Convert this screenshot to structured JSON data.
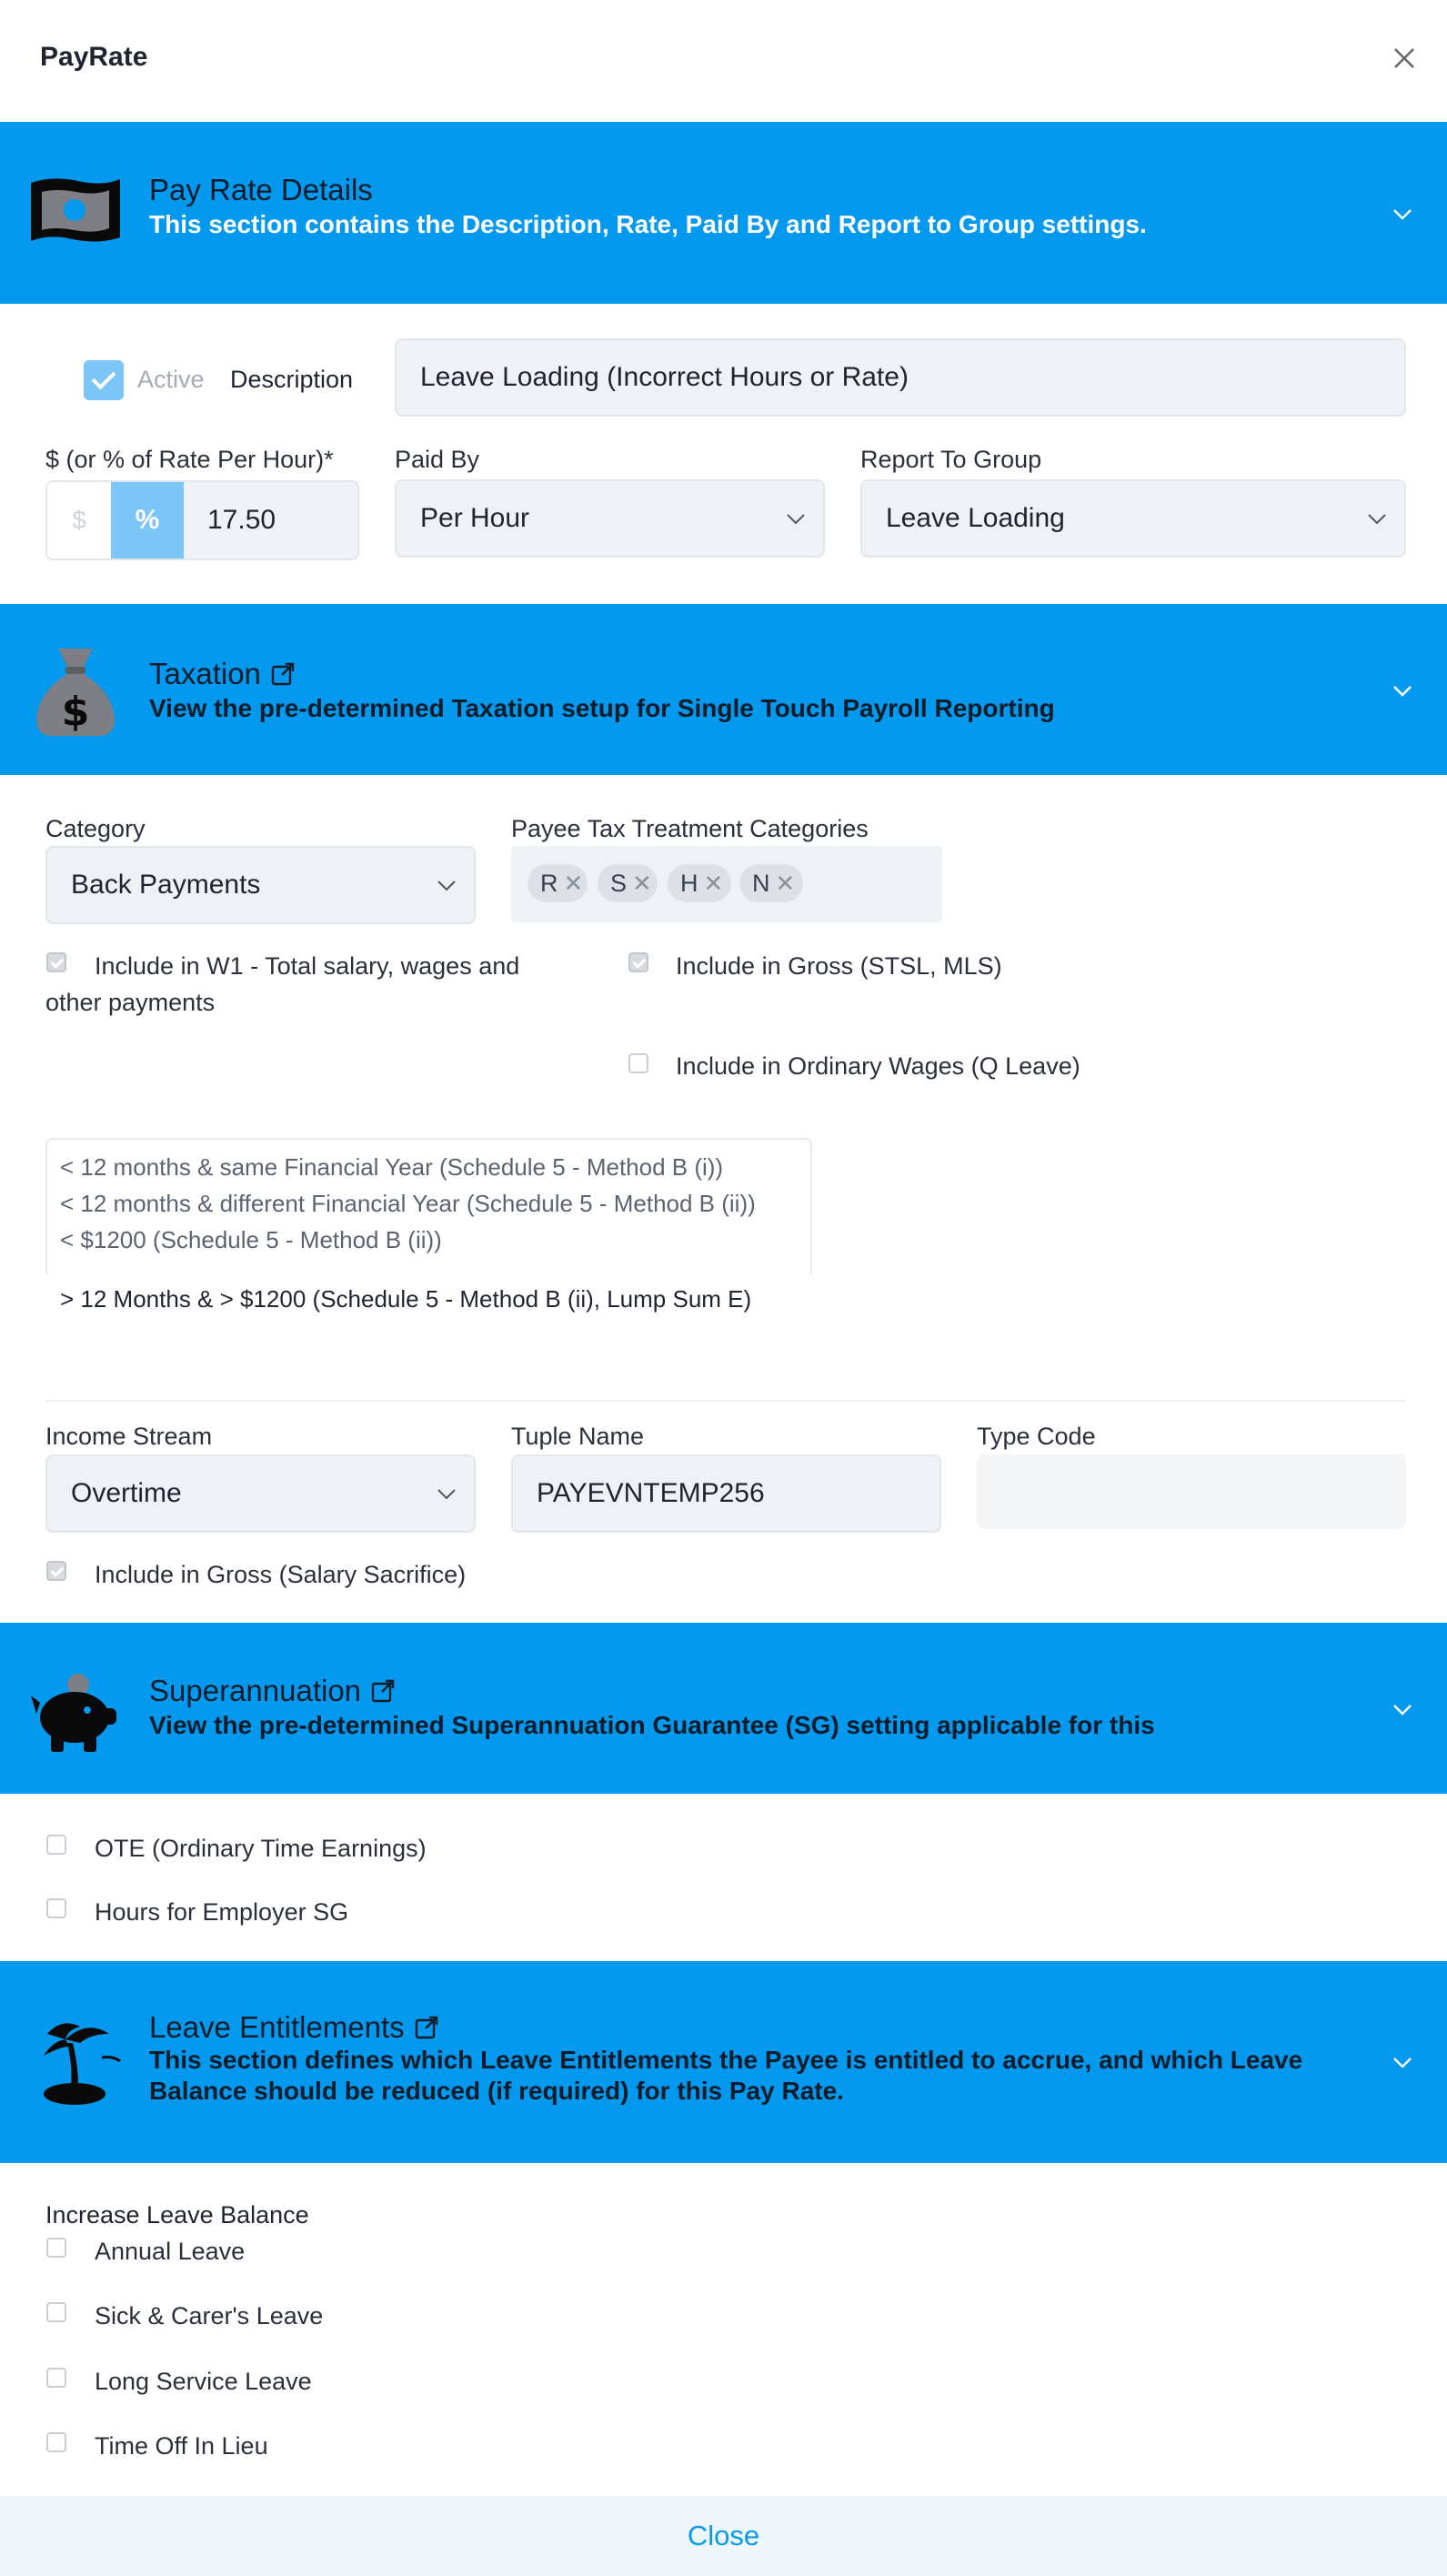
{
  "header": {
    "title": "PayRate",
    "close_icon": "close-icon"
  },
  "sections": {
    "pay_rate": {
      "icon": "banknote-icon",
      "title": "Pay Rate Details",
      "description": "This section contains the Description, Rate, Paid By and Report to Group settings."
    },
    "taxation": {
      "icon": "money-bag-icon",
      "title": "Taxation",
      "description": "View the pre-determined Taxation setup for Single Touch Payroll Reporting"
    },
    "superannuation": {
      "icon": "piggy-bank-icon",
      "title": "Superannuation",
      "description": "View the pre-determined Superannuation Guarantee (SG) setting applicable for this"
    },
    "leave": {
      "icon": "palm-island-icon",
      "title": "Leave Entitlements",
      "description": "This section defines which Leave Entitlements the Payee is entitled to accrue, and which Leave Balance should be reduced (if required) for this Pay Rate."
    }
  },
  "pay_rate_form": {
    "active_label": "Active",
    "active_checked": true,
    "description_label": "Description",
    "description_value": "Leave Loading (Incorrect Hours or Rate)",
    "rate_label": "$ (or % of Rate Per Hour)*",
    "rate_dollar": "$",
    "rate_percent": "%",
    "rate_value": "17.50",
    "paid_by_label": "Paid By",
    "paid_by_value": "Per Hour",
    "report_group_label": "Report To Group",
    "report_group_value": "Leave Loading"
  },
  "taxation_form": {
    "category_label": "Category",
    "category_value": "Back Payments",
    "payee_tax_label": "Payee Tax Treatment Categories",
    "tags": [
      "R",
      "S",
      "H",
      "N"
    ],
    "include_w1": "Include in W1 - Total salary, wages and other payments",
    "include_gross": "Include in Gross (STSL, MLS)",
    "include_ordinary": "Include in Ordinary Wages (Q Leave)",
    "lump_options": [
      "< 12 months & same Financial Year (Schedule 5 - Method B (i))",
      "< 12 months & different Financial Year (Schedule 5 - Method B (ii))",
      "< $1200 (Schedule 5 - Method B (ii))",
      "> 12 Months & > $1200 (Schedule 5 - Method B (ii), Lump Sum E)"
    ],
    "income_stream_label": "Income Stream",
    "income_stream_value": "Overtime",
    "tuple_name_label": "Tuple Name",
    "tuple_name_value": "PAYEVNTEMP256",
    "type_code_label": "Type Code",
    "type_code_value": "",
    "include_salary_sacrifice": "Include in Gross (Salary Sacrifice)"
  },
  "super_form": {
    "ote": "OTE (Ordinary Time Earnings)",
    "hours_sg": "Hours for Employer SG"
  },
  "leave_form": {
    "increase_label": "Increase Leave Balance",
    "annual": "Annual Leave",
    "sick": "Sick & Carer's Leave",
    "long_service": "Long Service Leave",
    "toil": "Time Off In Lieu"
  },
  "footer": {
    "close_label": "Close"
  },
  "colors": {
    "banner": "#0399ee",
    "accent": "#0b9ae8",
    "field_bg": "#eef1f5"
  }
}
